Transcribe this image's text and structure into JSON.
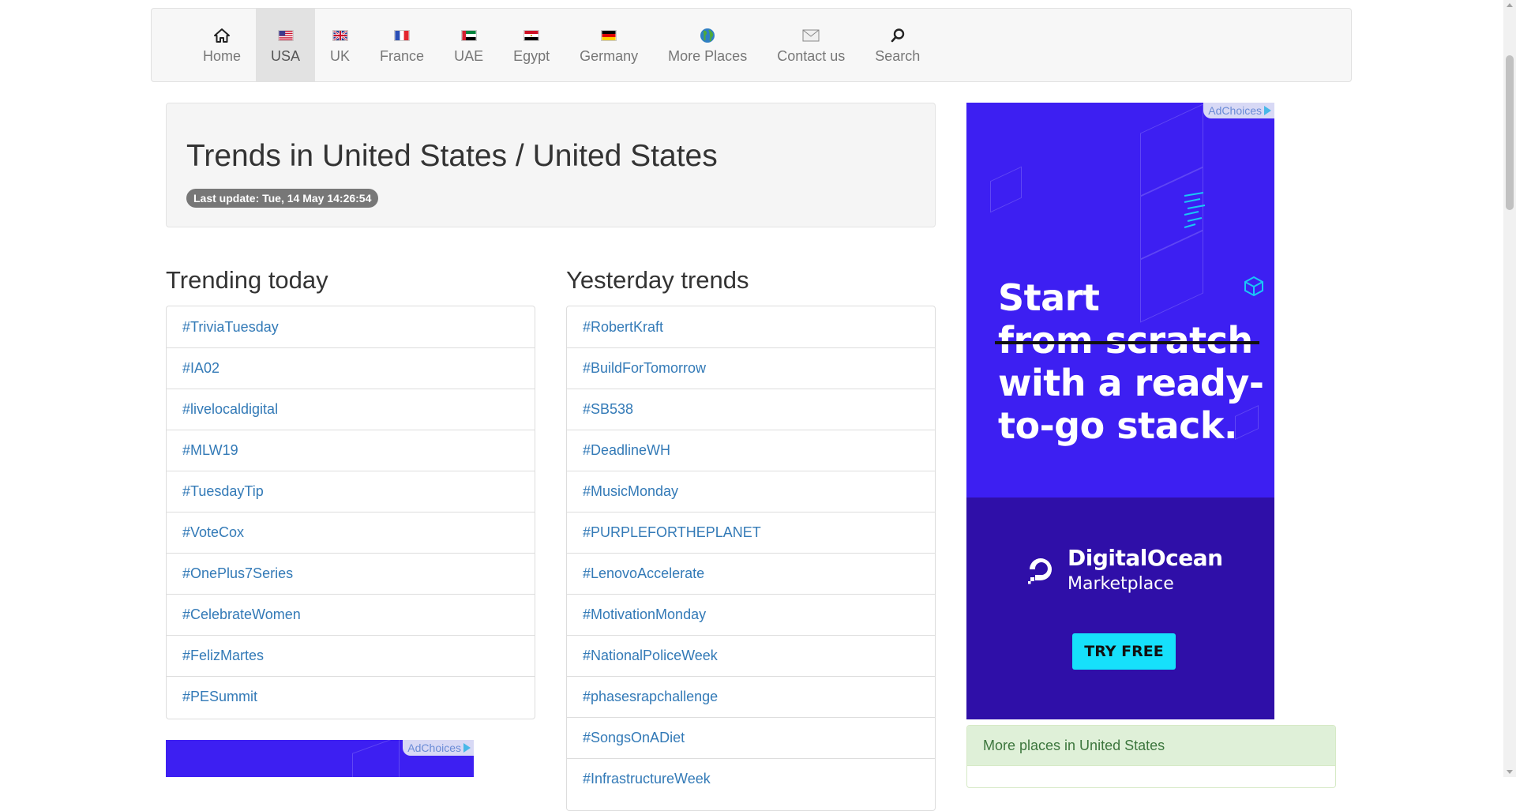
{
  "nav": {
    "items": [
      {
        "label": "Home",
        "icon": "home-icon",
        "active": false
      },
      {
        "label": "USA",
        "icon": "us-flag-icon",
        "active": true
      },
      {
        "label": "UK",
        "icon": "uk-flag-icon",
        "active": false
      },
      {
        "label": "France",
        "icon": "france-flag-icon",
        "active": false
      },
      {
        "label": "UAE",
        "icon": "uae-flag-icon",
        "active": false
      },
      {
        "label": "Egypt",
        "icon": "egypt-flag-icon",
        "active": false
      },
      {
        "label": "Germany",
        "icon": "germany-flag-icon",
        "active": false
      },
      {
        "label": "More Places",
        "icon": "globe-icon",
        "active": false
      },
      {
        "label": "Contact us",
        "icon": "envelope-icon",
        "active": false
      },
      {
        "label": "Search",
        "icon": "search-icon",
        "active": false
      }
    ]
  },
  "header": {
    "title": "Trends in United States / United States",
    "last_update": "Last update: Tue, 14 May 14:26:54"
  },
  "trending_today": {
    "title": "Trending today",
    "items": [
      "#TriviaTuesday",
      "#IA02",
      "#livelocaldigital",
      "#MLW19",
      "#TuesdayTip",
      "#VoteCox",
      "#OnePlus7Series",
      "#CelebrateWomen",
      "#FelizMartes",
      "#PESummit"
    ]
  },
  "yesterday_trends": {
    "title": "Yesterday trends",
    "items": [
      "#RobertKraft",
      "#BuildForTomorrow",
      "#SB538",
      "#DeadlineWH",
      "#MusicMonday",
      "#PURPLEFORTHEPLANET",
      "#LenovoAccelerate",
      "#MotivationMonday",
      "#NationalPoliceWeek",
      "#phasesrapchallenge",
      "#SongsOnADiet",
      "#InfrastructureWeek"
    ]
  },
  "ad": {
    "adchoices": "AdChoices",
    "line1": "Start",
    "line2_struck": "from scratch",
    "line3": "with a ready-",
    "line4": "to-go stack.",
    "brand": "DigitalOcean",
    "brand_sub": "Marketplace",
    "cta": "TRY FREE"
  },
  "more_places": {
    "title": "More places in United States"
  },
  "colors": {
    "link": "#337ab7",
    "ad_purple": "#3d1ff2",
    "ad_dark": "#2f0fa8",
    "cta_cyan": "#16e0fb",
    "success_bg": "#dff0d8"
  }
}
